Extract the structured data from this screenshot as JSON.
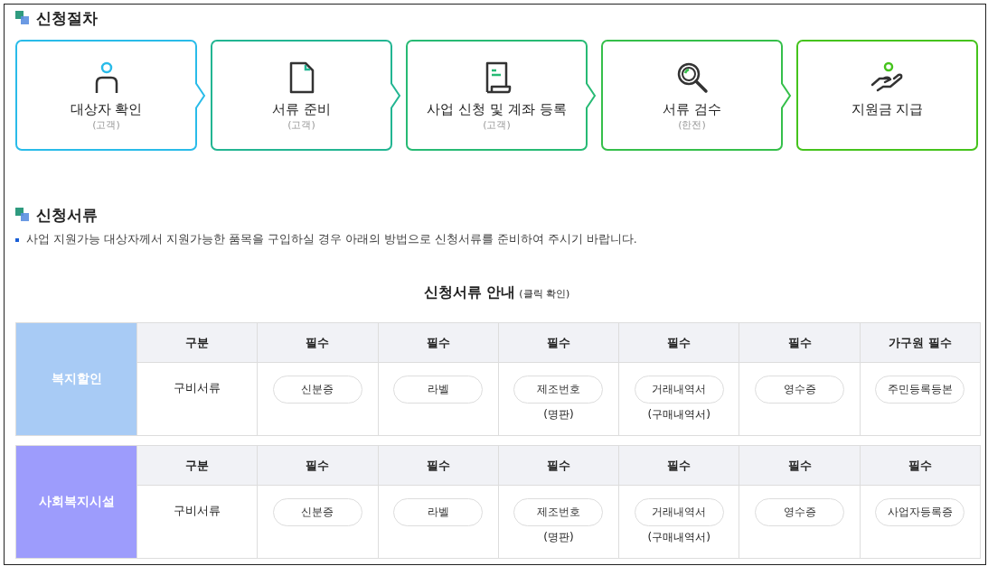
{
  "procedure": {
    "title": "신청절차",
    "steps": [
      {
        "label": "대상자 확인",
        "actor": "(고객)",
        "kind": "person",
        "color": "#29bbe9"
      },
      {
        "label": "서류 준비",
        "actor": "(고객)",
        "kind": "document",
        "color": "#22b592"
      },
      {
        "label": "사업 신청 및 계좌 등록",
        "actor": "(고객)",
        "kind": "scroll",
        "color": "#27ba74"
      },
      {
        "label": "서류 검수",
        "actor": "(한전)",
        "kind": "magnifier",
        "color": "#35bf4a"
      },
      {
        "label": "지원금 지급",
        "kind": "hand",
        "color": "#45c31c"
      }
    ]
  },
  "documents": {
    "title": "신청서류",
    "note": "사업 지원가능 대상자께서 지원가능한 품목을 구입하실 경우 아래의 방법으로 신청서류를 준비하여 주시기 바랍니다.",
    "guide_title": "신청서류 안내",
    "guide_hint": "(클릭 확인)",
    "groups": [
      {
        "name": "복지할인",
        "color": "#a8cbf5",
        "header": [
          "구분",
          "필수",
          "필수",
          "필수",
          "필수",
          "필수",
          "가구원 필수"
        ],
        "row_label": "구비서류",
        "items": [
          {
            "label": "신분증"
          },
          {
            "label": "라벨"
          },
          {
            "label": "제조번호",
            "note": "(명판)"
          },
          {
            "label": "거래내역서",
            "note": "(구매내역서)"
          },
          {
            "label": "영수증"
          },
          {
            "label": "주민등록등본"
          }
        ]
      },
      {
        "name": "사회복지시설",
        "color": "#9d9cfc",
        "header": [
          "구분",
          "필수",
          "필수",
          "필수",
          "필수",
          "필수",
          "필수"
        ],
        "row_label": "구비서류",
        "items": [
          {
            "label": "신분증"
          },
          {
            "label": "라벨"
          },
          {
            "label": "제조번호",
            "note": "(명판)"
          },
          {
            "label": "거래내역서",
            "note": "(구매내역서)"
          },
          {
            "label": "영수증"
          },
          {
            "label": "사업자등록증"
          }
        ]
      }
    ]
  }
}
